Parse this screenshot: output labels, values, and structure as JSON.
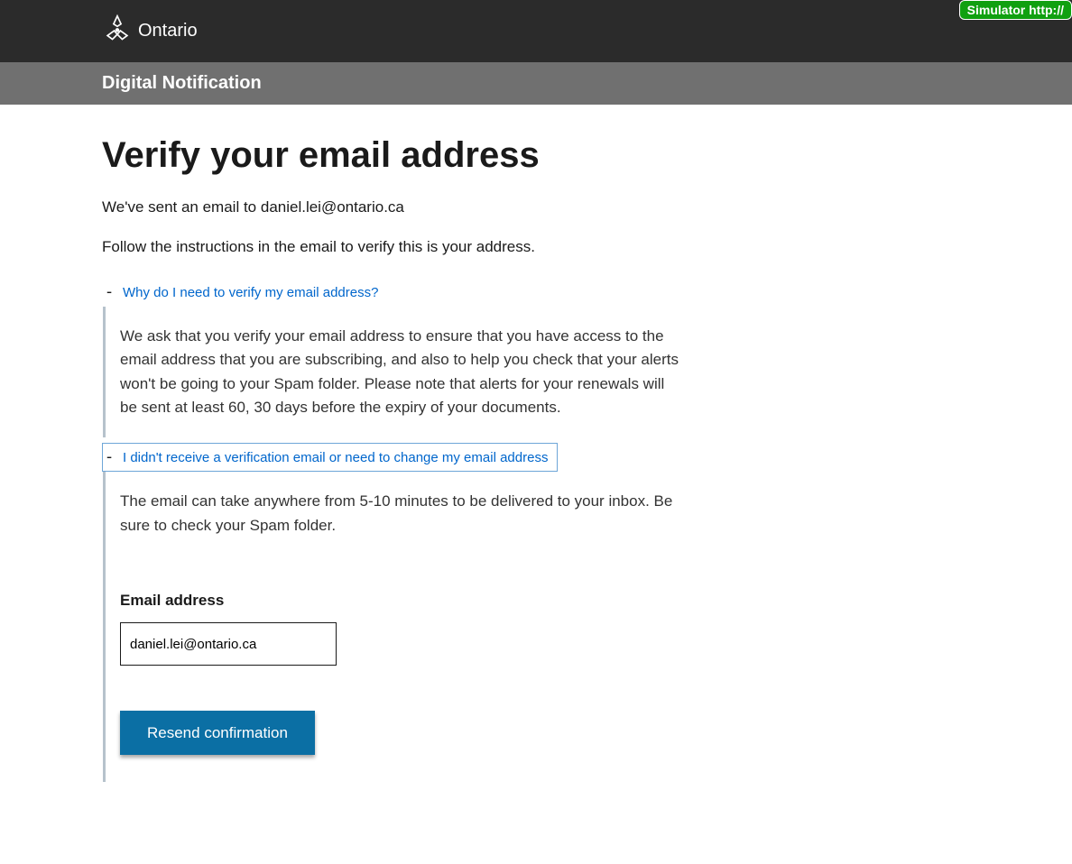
{
  "sim_badge": "Simulator http://",
  "brand": "Ontario",
  "sub_bar": "Digital Notification",
  "page_title": "Verify your email address",
  "intro_line1_prefix": "We've sent an email to ",
  "intro_line1_email": "daniel.lei@ontario.ca",
  "intro_line2": "Follow the instructions in the email to verify this is your address.",
  "accordion": [
    {
      "label": "Why do I need to verify my email address?",
      "body": "We ask that you verify your email address to ensure that you have access to the email address that you are subscribing, and also to help you check that your alerts won't be going to your Spam folder. Please note that alerts for your renewals will be sent at least 60, 30 days before the expiry of your documents."
    },
    {
      "label": "I didn't receive a verification email or need to change my email address",
      "body": "The email can take anywhere from 5-10 minutes to be delivered to your inbox. Be sure to check your Spam folder."
    }
  ],
  "email_field_label": "Email address",
  "email_field_value": "daniel.lei@ontario.ca",
  "resend_button": "Resend confirmation",
  "colors": {
    "link": "#0066cc",
    "primary_button": "#0b6fa4",
    "topbar": "#2b2b2b",
    "subbar": "#707070",
    "focus": "#6ea6d8",
    "sim_badge": "#10a010"
  }
}
